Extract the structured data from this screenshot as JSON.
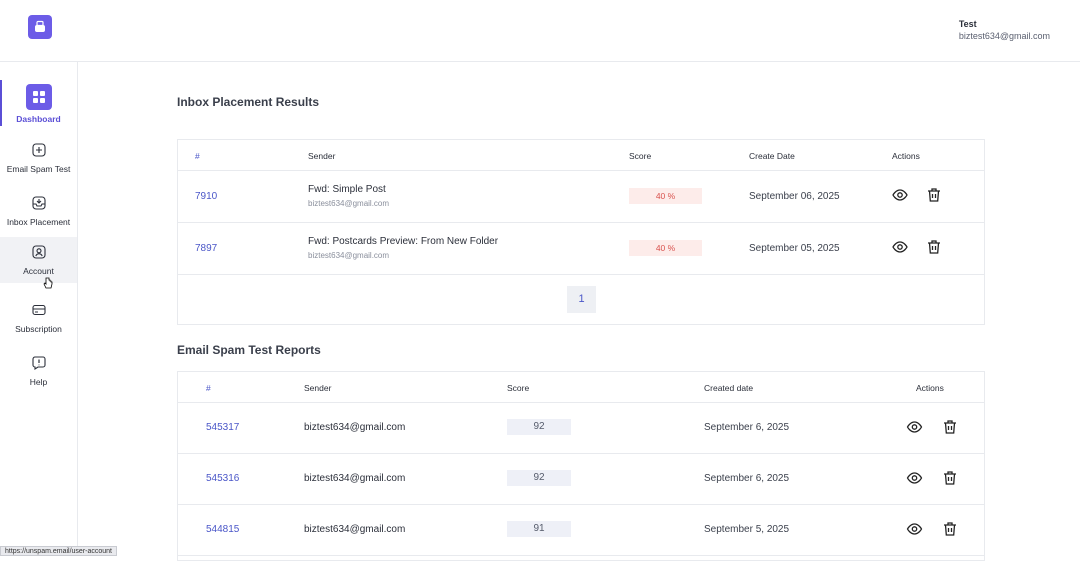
{
  "user": {
    "name": "Test",
    "email": "biztest634@gmail.com"
  },
  "sidebar": {
    "items": [
      {
        "label": "Dashboard",
        "icon": "dashboard-grid-icon",
        "active": true
      },
      {
        "label": "Email Spam Test",
        "icon": "plus-square-icon"
      },
      {
        "label": "Inbox Placement",
        "icon": "inbox-icon"
      },
      {
        "label": "Account",
        "icon": "user-icon"
      },
      {
        "label": "Subscription",
        "icon": "card-icon"
      },
      {
        "label": "Help",
        "icon": "help-icon"
      }
    ]
  },
  "inbox_placement": {
    "title": "Inbox Placement Results",
    "columns": [
      "#",
      "Sender",
      "Score",
      "Create Date",
      "Actions"
    ],
    "rows": [
      {
        "id": "7910",
        "subject": "Fwd: Simple Post",
        "email": "biztest634@gmail.com",
        "score": "40 %",
        "date": "September 06, 2025"
      },
      {
        "id": "7897",
        "subject": "Fwd: Postcards Preview: From New Folder",
        "email": "biztest634@gmail.com",
        "score": "40 %",
        "date": "September 05, 2025"
      }
    ],
    "page": "1"
  },
  "spam_reports": {
    "title": "Email Spam Test Reports",
    "columns": [
      "#",
      "Sender",
      "Score",
      "Created date",
      "Actions"
    ],
    "rows": [
      {
        "id": "545317",
        "sender": "biztest634@gmail.com",
        "score": "92",
        "date": "September 6, 2025"
      },
      {
        "id": "545316",
        "sender": "biztest634@gmail.com",
        "score": "92",
        "date": "September 6, 2025"
      },
      {
        "id": "544815",
        "sender": "biztest634@gmail.com",
        "score": "91",
        "date": "September 5, 2025"
      }
    ]
  },
  "status_bar": {
    "url": "https://unspam.email/user-account"
  },
  "colors": {
    "accent": "#6c5ce7",
    "link": "#4a56c8",
    "score_bad_bg": "#fdecea",
    "score_bad_text": "#d9534f"
  }
}
